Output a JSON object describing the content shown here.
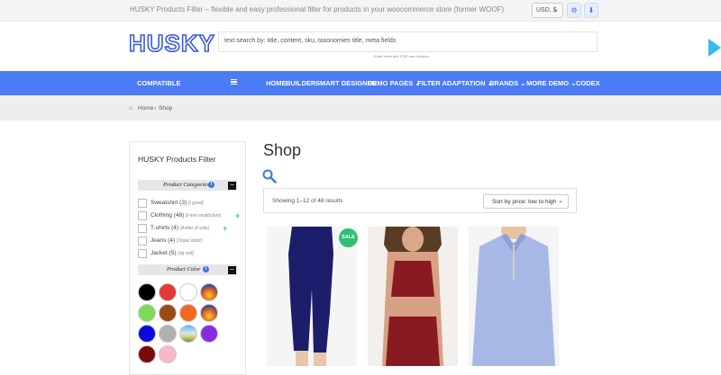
{
  "topbar": {
    "tagline": "HUSKY Products Filter – flexible and easy professional filter for products in your woocommerce store (former WOOF)",
    "currency": "USD, $"
  },
  "header": {
    "logo_text": "HUSKY",
    "search_placeholder": "text search by: title, content, sku, taxonomies title, meta fields",
    "search_hint": "Enter three dev 3795 max session"
  },
  "nav": {
    "items": [
      "COMPATIBLE",
      "HOME",
      "BUILDER",
      "SMART DESIGNER",
      "DEMO PAGES",
      "FILTER ADAPTATION",
      "BRANDS",
      "MORE DEMO",
      "CODEX"
    ]
  },
  "breadcrumb": {
    "home": "Home",
    "separator": "›",
    "current": "Shop"
  },
  "sidebar": {
    "title": "HUSKY Products Filter",
    "categories_heading": "Product Categories",
    "categories": [
      {
        "name": "Sweatshirt",
        "count": "(3)",
        "note": "[I good]"
      },
      {
        "name": "Clothing",
        "count": "(48)",
        "note": "[t-test vestibulum]"
      },
      {
        "name": "T-shirts",
        "count": "(4)",
        "note": "[Antler of side]"
      },
      {
        "name": "Jeans",
        "count": "(4)",
        "note": "[Unpel dolor]"
      },
      {
        "name": "Jacket",
        "count": "(5)",
        "note": "[rig volt]"
      }
    ],
    "color_heading": "Product Color",
    "colors": [
      "#000000",
      "#e63838",
      "#ffffff",
      "sunset",
      "#7ed957",
      "#9a4a12",
      "#f06a22",
      "sunset",
      "#0a0adf",
      "#b0b0b0",
      "landscape",
      "#8a2be2",
      "#7a0a0a",
      "#f7b8c8"
    ]
  },
  "main": {
    "title": "Shop",
    "result_count": "Showing 1–12 of 48 results",
    "sort_selected": "Sort by price: low to high",
    "sale_badge": "SALE"
  }
}
